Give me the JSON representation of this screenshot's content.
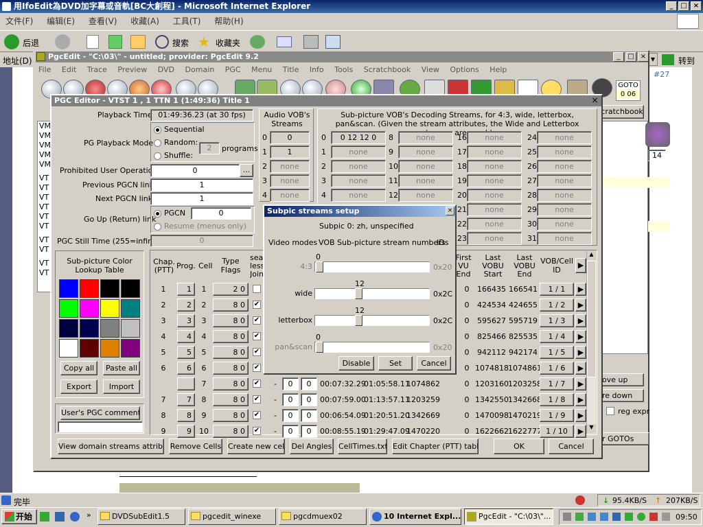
{
  "ie": {
    "title": "用IfoEdit為DVD加字幕或音軌[BC大創程] - Microsoft Internet Explorer",
    "menu": [
      "文件(F)",
      "编辑(E)",
      "查看(V)",
      "收藏(A)",
      "工具(T)",
      "帮助(H)"
    ],
    "back_label": "后退",
    "search_label": "搜索",
    "favorites_label": "收藏夹",
    "address_label": "地址(D)",
    "go_label": "转到",
    "status_text": "完毕",
    "download_speed": "95.4KB/S",
    "upload_speed": "207KB/S"
  },
  "pgcedit": {
    "title": "PgcEdit -  \"C:\\03\\\" - untitled; provider: PgcEdit 9.2",
    "menu": [
      "File",
      "Edit",
      "Trace",
      "Preview",
      "DVD",
      "Domain",
      "PGC",
      "Menu",
      "Title",
      "Info",
      "Tools",
      "Scratchbook",
      "View",
      "Options",
      "Help"
    ],
    "goto_label": "GOTO",
    "goto_value": "0  06",
    "scratchbook_label": "cratchbook",
    "right_number": "#27",
    "side_labels": [
      "VM",
      "VM",
      "VM",
      "VM",
      "VM",
      "VT",
      "VT",
      "VT",
      "VT",
      "VT",
      "VT",
      "VT",
      "VT",
      "VT",
      "VT"
    ],
    "right_buttons": [
      "ove up",
      "re down",
      "reg expr",
      "r GOTOs",
      "r GOTOs"
    ],
    "right_field": "14"
  },
  "pgc_editor": {
    "title": "PGC Editor - VTST 1 , 1   TTN 1  (1:49:36)  Title 1",
    "playback_time_label": "Playback Time",
    "playback_time_value": "01:49:36.23 (at 30 fps)",
    "pg_mode_label": "PG Playback Mode",
    "mode_sequential": "Sequential",
    "mode_random": "Random:",
    "mode_shuffle": "Shuffle:",
    "programs_value": "2",
    "programs_label": "programs",
    "prohibited_label": "Prohibited User Operations",
    "prohibited_value": "0",
    "prev_label": "Previous PGCN link",
    "prev_value": "1",
    "next_label": "Next PGCN link",
    "next_value": "1",
    "goup_label": "Go Up (Return) link",
    "pgcn_label": "PGCN",
    "pgcn_value": "0",
    "resume_label": "Resume (menus only)",
    "still_label": "PGC Still Time (255=infinite)",
    "still_value": "0",
    "audio_header": "Audio VOB's Streams",
    "audio_streams": [
      [
        "0",
        "0"
      ],
      [
        "1",
        "1"
      ],
      [
        "2",
        "none"
      ],
      [
        "3",
        "none"
      ],
      [
        "4",
        "none"
      ]
    ],
    "subpic_header": "Sub-picture VOB's Decoding Streams, for 4:3, wide, letterbox, pan&scan. (Given the stream attributes, the Wide and Letterbox streams are used.)",
    "subpic_col1": [
      [
        "0",
        "0  12  12   0"
      ],
      [
        "1",
        "none"
      ],
      [
        "2",
        "none"
      ],
      [
        "3",
        "none"
      ],
      [
        "4",
        "none"
      ]
    ],
    "subpic_col2": [
      [
        "8",
        "none"
      ],
      [
        "9",
        "none"
      ],
      [
        "10",
        "none"
      ],
      [
        "11",
        "none"
      ],
      [
        "12",
        "none"
      ]
    ],
    "subpic_col3": [
      [
        "16",
        "none"
      ],
      [
        "17",
        "none"
      ],
      [
        "18",
        "none"
      ],
      [
        "19",
        "none"
      ],
      [
        "20",
        "none"
      ],
      [
        "21",
        "none"
      ],
      [
        "22",
        "none"
      ],
      [
        "23",
        "none"
      ]
    ],
    "subpic_col4": [
      [
        "24",
        "none"
      ],
      [
        "25",
        "none"
      ],
      [
        "26",
        "none"
      ],
      [
        "27",
        "none"
      ],
      [
        "28",
        "none"
      ],
      [
        "29",
        "none"
      ],
      [
        "30",
        "none"
      ],
      [
        "31",
        "none"
      ]
    ],
    "color_table_label": "Sub-picture Color Lookup Table",
    "colors": [
      "#0000ff",
      "#ff0000",
      "#000000",
      "#000000",
      "#00ff00",
      "#ff00ff",
      "#ffff00",
      "#008080",
      "#000040",
      "#000050",
      "#808080",
      "#c0c0c0",
      "#ffffff",
      "#600000",
      "#e08000",
      "#800080"
    ],
    "copy_all": "Copy all",
    "paste_all": "Paste all",
    "export": "Export",
    "import": "Import",
    "comment_label": "User's PGC comment",
    "cell_headers": [
      "Chap. (PTT)",
      "Prog.",
      "Cell",
      "Type Flags",
      "sea less Join"
    ],
    "cell_headers_right": [
      "First VU End",
      "Last VOBU Start",
      "Last VOBU End",
      "VOB/Cell ID"
    ],
    "cell_rows": [
      {
        "chap": "1",
        "prog": "1",
        "cell": "1",
        "flags": "2  0",
        "zero": "",
        "t1": "",
        "t2": "",
        "sector": "",
        "first": "0",
        "last_start": "166435",
        "last_end": "166541",
        "id": "1 / 1"
      },
      {
        "chap": "2",
        "prog": "2",
        "cell": "2",
        "flags": "8  0",
        "zero": "",
        "t1": "",
        "t2": "",
        "sector": "",
        "first": "0",
        "last_start": "424534",
        "last_end": "424655",
        "id": "1 / 2"
      },
      {
        "chap": "3",
        "prog": "3",
        "cell": "3",
        "flags": "8  0",
        "zero": "",
        "t1": "",
        "t2": "",
        "sector": "",
        "first": "0",
        "last_start": "595627",
        "last_end": "595719",
        "id": "1 / 3"
      },
      {
        "chap": "4",
        "prog": "4",
        "cell": "4",
        "flags": "8  0",
        "zero": "",
        "t1": "",
        "t2": "",
        "sector": "",
        "first": "0",
        "last_start": "825466",
        "last_end": "825535",
        "id": "1 / 4"
      },
      {
        "chap": "5",
        "prog": "5",
        "cell": "5",
        "flags": "8  0",
        "zero": "",
        "t1": "",
        "t2": "",
        "sector": "",
        "first": "0",
        "last_start": "942112",
        "last_end": "942174",
        "id": "1 / 5"
      },
      {
        "chap": "6",
        "prog": "6",
        "cell": "6",
        "flags": "8  0",
        "zero": "",
        "t1": "",
        "t2": "",
        "sector": "",
        "first": "0",
        "last_start": "1074818",
        "last_end": "1074861",
        "id": "1 / 6"
      },
      {
        "chap": "",
        "prog": "",
        "cell": "7",
        "flags": "8  0",
        "zero": "0",
        "t1": "00:07:32.29",
        "t2": "01:05:58.11",
        "sector": "1074862",
        "first": "0",
        "last_start": "1203160",
        "last_end": "1203258",
        "id": "1 / 7"
      },
      {
        "chap": "7",
        "prog": "7",
        "cell": "8",
        "flags": "8  0",
        "zero": "0",
        "t1": "00:07:59.00",
        "t2": "01:13:57.11",
        "sector": "1203259",
        "first": "0",
        "last_start": "1342550",
        "last_end": "1342668",
        "id": "1 / 8"
      },
      {
        "chap": "8",
        "prog": "8",
        "cell": "9",
        "flags": "8  0",
        "zero": "0",
        "t1": "00:06:54.09",
        "t2": "01:20:51.20",
        "sector": "1342669",
        "first": "0",
        "last_start": "1470098",
        "last_end": "1470219",
        "id": "1 / 9"
      },
      {
        "chap": "9",
        "prog": "9",
        "cell": "10",
        "flags": "8  0",
        "zero": "0",
        "t1": "00:08:55.19",
        "t2": "01:29:47.09",
        "sector": "1470220",
        "first": "0",
        "last_start": "1622662",
        "last_end": "1622777",
        "id": "1 / 10"
      }
    ],
    "bottom_buttons": [
      "View domain streams attributes",
      "Remove Cells",
      "Create new cell",
      "Del Angles",
      "CellTimes.txt",
      "Edit Chapter (PTT) table",
      "OK",
      "Cancel"
    ]
  },
  "subpic_dialog": {
    "title": "Subpic streams setup",
    "subtitle": "Subpic 0: zh, unspecified",
    "col_modes": "Video modes",
    "col_numbers": "VOB Sub-picture stream numbers",
    "col_ids": "IDs",
    "rows": [
      {
        "mode": "4:3",
        "value": "0",
        "id": "0x20",
        "level": 0.0,
        "enabled": false
      },
      {
        "mode": "wide",
        "value": "12",
        "id": "0x2C",
        "level": 0.375,
        "enabled": true
      },
      {
        "mode": "letterbox",
        "value": "12",
        "id": "0x2C",
        "level": 0.375,
        "enabled": true
      },
      {
        "mode": "pan&scan",
        "value": "0",
        "id": "0x20",
        "level": 0.0,
        "enabled": false
      }
    ],
    "disable": "Disable",
    "set": "Set",
    "cancel": "Cancel"
  },
  "taskbar": {
    "start": "开始",
    "tasks": [
      "DVDSubEdit1.5",
      "pgcedit_winexe",
      "pgcdmuex02",
      "10 Internet Expl...",
      "PgcEdit - \"C:\\03\\\"..."
    ],
    "clock": "09:50"
  }
}
